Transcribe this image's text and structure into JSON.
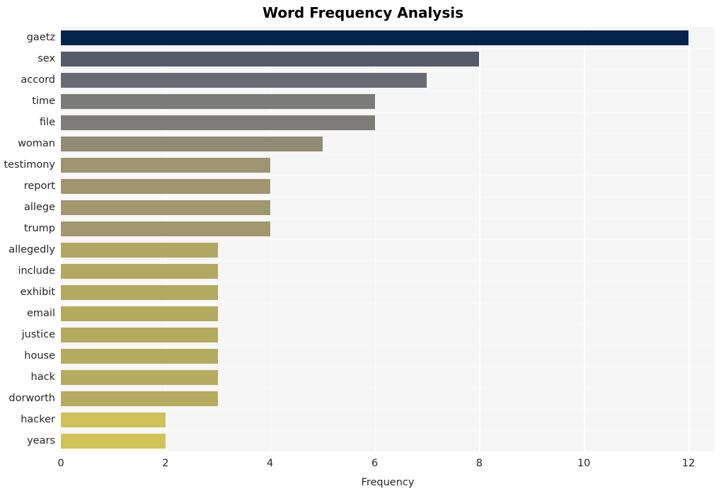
{
  "chart_data": {
    "type": "bar",
    "orientation": "horizontal",
    "title": "Word Frequency Analysis",
    "xlabel": "Frequency",
    "ylabel": "",
    "xlim": [
      0,
      12.5
    ],
    "xticks": [
      "0",
      "2",
      "4",
      "6",
      "8",
      "10",
      "12"
    ],
    "xtick_values": [
      0,
      2,
      4,
      6,
      8,
      10,
      12
    ],
    "grid": true,
    "grid_color": "#ffffff",
    "legend": "none",
    "plot_background": "#f6f6f7",
    "figure_background": "#ffffff",
    "categories": [
      "gaetz",
      "sex",
      "accord",
      "time",
      "file",
      "woman",
      "testimony",
      "report",
      "allege",
      "trump",
      "allegedly",
      "include",
      "exhibit",
      "email",
      "justice",
      "house",
      "hack",
      "dorworth",
      "hacker",
      "years"
    ],
    "values": [
      12,
      8,
      7,
      6,
      6,
      5,
      4,
      4,
      4,
      4,
      3,
      3,
      3,
      3,
      3,
      3,
      3,
      3,
      2,
      2
    ],
    "bar_colors": [
      "#04244d",
      "#555b6b",
      "#686b73",
      "#7b7b79",
      "#7e7d79",
      "#918b75",
      "#9d9471",
      "#9f966f",
      "#a0976f",
      "#a1986e",
      "#b0a762",
      "#b2a861",
      "#b3a961",
      "#b3aa60",
      "#b4aa60",
      "#b4ab60",
      "#b5ab5f",
      "#b6ac5f",
      "#d0c158",
      "#d2c356"
    ]
  }
}
